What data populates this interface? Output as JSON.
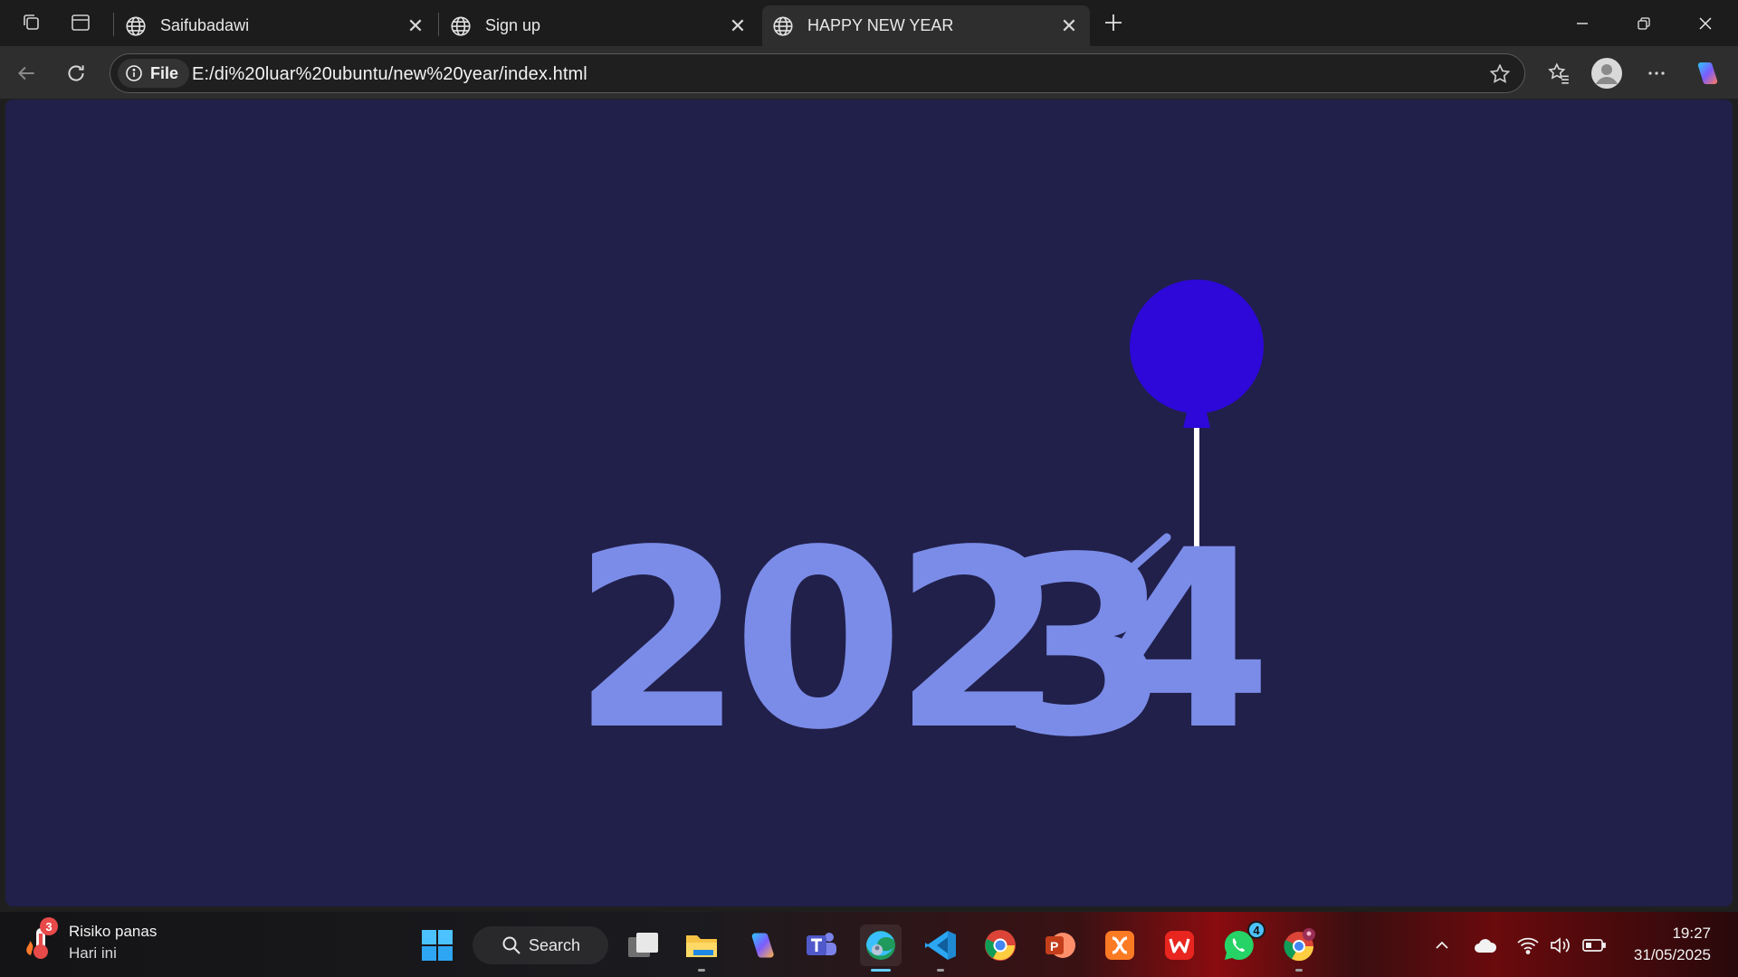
{
  "browser": {
    "tabs": [
      {
        "title": "Saifubadawi",
        "active": false
      },
      {
        "title": "Sign up",
        "active": false
      },
      {
        "title": "HAPPY NEW YEAR",
        "active": true
      }
    ],
    "address": {
      "chip": "File",
      "url": "E:/di%20luar%20ubuntu/new%20year/index.html"
    }
  },
  "page": {
    "background": "#21204a",
    "text_color": "#7b8ce8",
    "balloon_color": "#2d08d8",
    "digits_static": "202",
    "digit_old": "3",
    "digit_new": "4"
  },
  "taskbar": {
    "weather": {
      "title": "Risiko panas",
      "subtitle": "Hari ini",
      "badge": "3"
    },
    "search_label": "Search",
    "apps": [
      {
        "name": "start-icon"
      },
      {
        "name": "task-view-icon"
      },
      {
        "name": "file-explorer-icon"
      },
      {
        "name": "copilot-icon"
      },
      {
        "name": "teams-icon"
      },
      {
        "name": "edge-icon"
      },
      {
        "name": "vscode-icon"
      },
      {
        "name": "chrome-icon"
      },
      {
        "name": "powerpoint-icon"
      },
      {
        "name": "xampp-icon"
      },
      {
        "name": "wps-office-icon"
      },
      {
        "name": "whatsapp-icon",
        "badge": "4"
      },
      {
        "name": "chrome-profile-icon"
      }
    ],
    "clock": {
      "time": "19:27",
      "date": "31/05/2025"
    }
  }
}
